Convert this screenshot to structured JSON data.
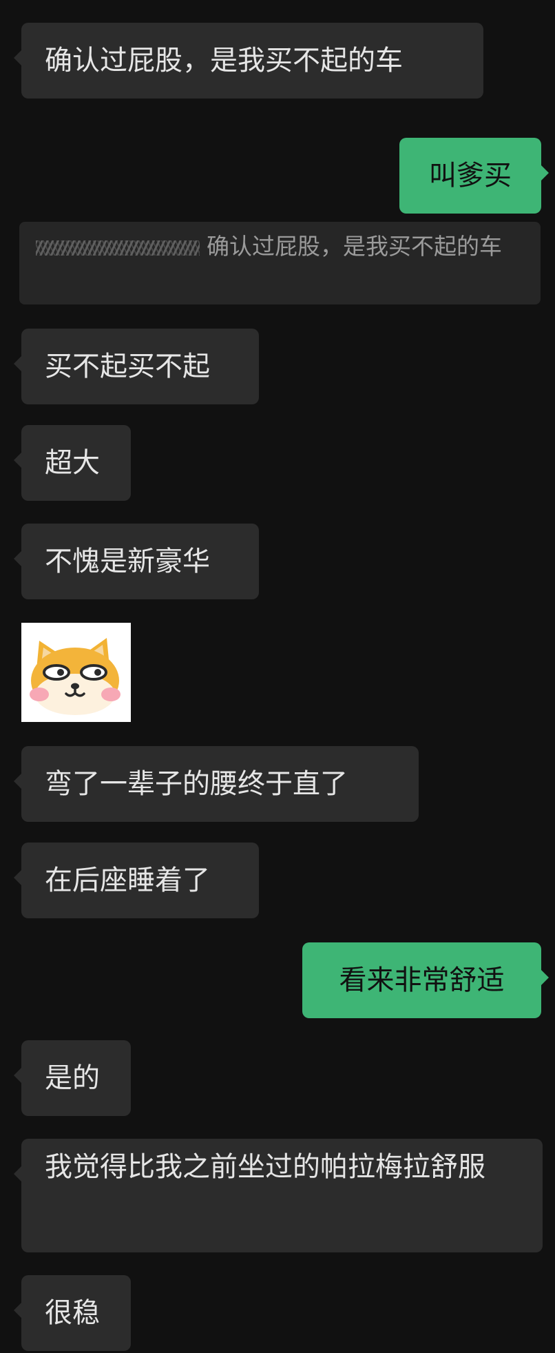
{
  "chat": {
    "messages": [
      {
        "side": "in",
        "text": "确认过屁股，是我买不起的车"
      },
      {
        "side": "out",
        "text": "叫爹买"
      },
      {
        "type": "quote",
        "text": "确认过屁股，是我买不起的车"
      },
      {
        "side": "in",
        "text": "买不起买不起"
      },
      {
        "side": "in",
        "text": "超大"
      },
      {
        "side": "in",
        "text": "不愧是新豪华"
      },
      {
        "type": "sticker",
        "icon": "shiba-dog-sticker-icon"
      },
      {
        "side": "in",
        "text": "弯了一辈子的腰终于直了"
      },
      {
        "side": "in",
        "text": "在后座睡着了"
      },
      {
        "side": "out",
        "text": "看来非常舒适"
      },
      {
        "side": "in",
        "text": "是的"
      },
      {
        "side": "in",
        "text": "我觉得比我之前坐过的帕拉梅拉舒服"
      },
      {
        "side": "in",
        "text": "很稳"
      }
    ]
  },
  "colors": {
    "background": "#111111",
    "incoming_bubble": "#2c2c2c",
    "outgoing_bubble": "#3eb575"
  }
}
